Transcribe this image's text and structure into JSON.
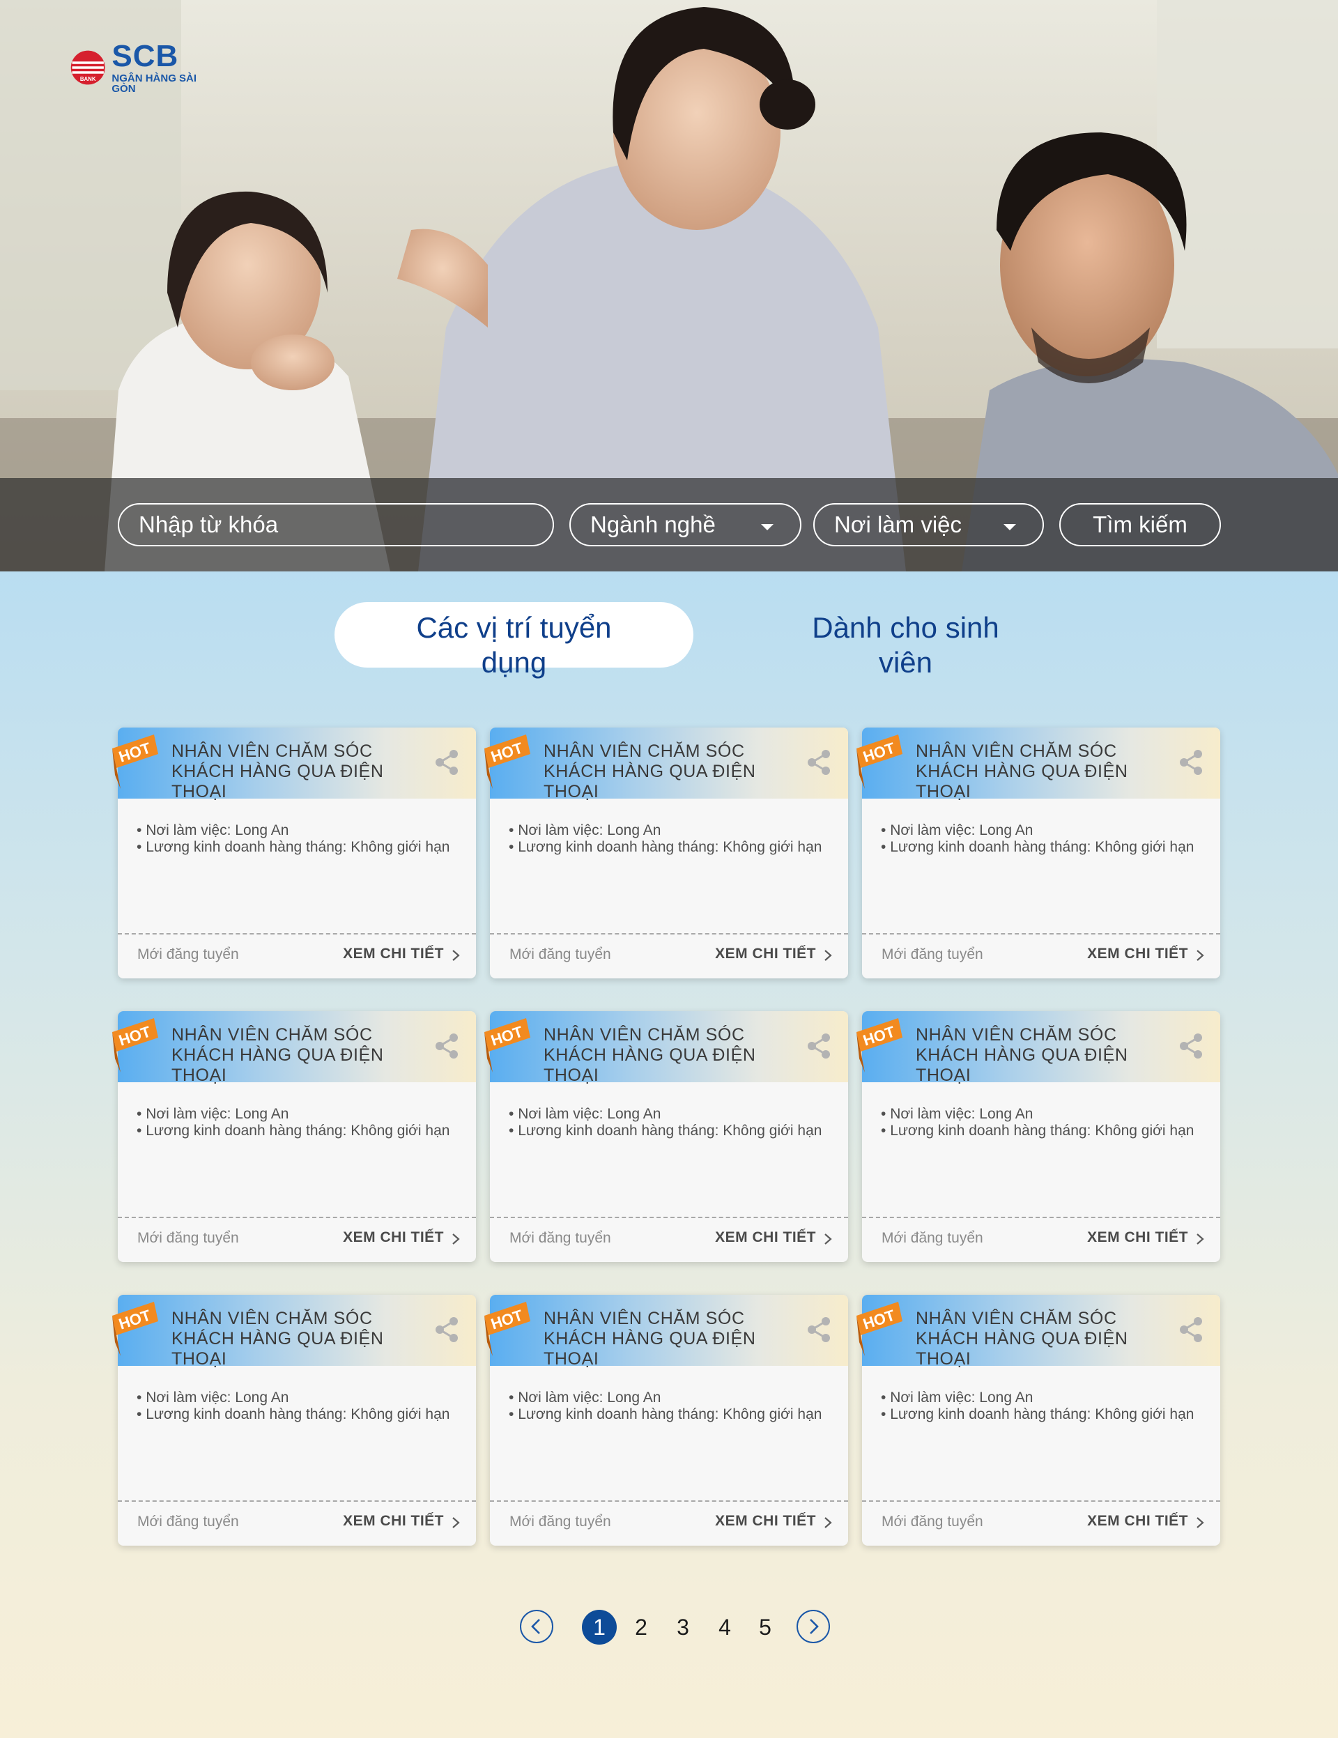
{
  "brand": {
    "name": "SCB",
    "subtitle": "NGÂN HÀNG SÀI GÒN",
    "mark_text": "BANK",
    "colors": {
      "primary": "#1a57a8",
      "accent": "#d6202e",
      "hot": "#f28a1f"
    }
  },
  "search": {
    "keyword_placeholder": "Nhập từ khóa",
    "industry_placeholder": "Ngành nghề",
    "location_placeholder": "Nơi làm việc",
    "submit_label": "Tìm kiếm"
  },
  "tabs": [
    {
      "label": "Các vị trí tuyển dụng",
      "active": true
    },
    {
      "label": "Dành cho sinh viên",
      "active": false
    }
  ],
  "jobs": [
    {
      "badge": "HOT",
      "title": "NHÂN VIÊN CHĂM SÓC KHÁCH HÀNG QUA ĐIỆN THOẠI",
      "location": "Nơi làm việc: Long An",
      "salary": "Lương kinh doanh hàng tháng: Không giới hạn",
      "status": "Mới đăng tuyển",
      "cta": "XEM CHI TIẾT"
    },
    {
      "badge": "HOT",
      "title": "NHÂN VIÊN CHĂM SÓC KHÁCH HÀNG QUA ĐIỆN THOẠI",
      "location": "Nơi làm việc: Long An",
      "salary": "Lương kinh doanh hàng tháng: Không giới hạn",
      "status": "Mới đăng tuyển",
      "cta": "XEM CHI TIẾT"
    },
    {
      "badge": "HOT",
      "title": "NHÂN VIÊN CHĂM SÓC KHÁCH HÀNG QUA ĐIỆN THOẠI",
      "location": "Nơi làm việc: Long An",
      "salary": "Lương kinh doanh hàng tháng: Không giới hạn",
      "status": "Mới đăng tuyển",
      "cta": "XEM CHI TIẾT"
    },
    {
      "badge": "HOT",
      "title": "NHÂN VIÊN CHĂM SÓC KHÁCH HÀNG QUA ĐIỆN THOẠI",
      "location": "Nơi làm việc: Long An",
      "salary": "Lương kinh doanh hàng tháng: Không giới hạn",
      "status": "Mới đăng tuyển",
      "cta": "XEM CHI TIẾT"
    },
    {
      "badge": "HOT",
      "title": "NHÂN VIÊN CHĂM SÓC KHÁCH HÀNG QUA ĐIỆN THOẠI",
      "location": "Nơi làm việc: Long An",
      "salary": "Lương kinh doanh hàng tháng: Không giới hạn",
      "status": "Mới đăng tuyển",
      "cta": "XEM CHI TIẾT"
    },
    {
      "badge": "HOT",
      "title": "NHÂN VIÊN CHĂM SÓC KHÁCH HÀNG QUA ĐIỆN THOẠI",
      "location": "Nơi làm việc: Long An",
      "salary": "Lương kinh doanh hàng tháng: Không giới hạn",
      "status": "Mới đăng tuyển",
      "cta": "XEM CHI TIẾT"
    },
    {
      "badge": "HOT",
      "title": "NHÂN VIÊN CHĂM SÓC KHÁCH HÀNG QUA ĐIỆN THOẠI",
      "location": "Nơi làm việc: Long An",
      "salary": "Lương kinh doanh hàng tháng: Không giới hạn",
      "status": "Mới đăng tuyển",
      "cta": "XEM CHI TIẾT"
    },
    {
      "badge": "HOT",
      "title": "NHÂN VIÊN CHĂM SÓC KHÁCH HÀNG QUA ĐIỆN THOẠI",
      "location": "Nơi làm việc: Long An",
      "salary": "Lương kinh doanh hàng tháng: Không giới hạn",
      "status": "Mới đăng tuyển",
      "cta": "XEM CHI TIẾT"
    },
    {
      "badge": "HOT",
      "title": "NHÂN VIÊN CHĂM SÓC KHÁCH HÀNG QUA ĐIỆN THOẠI",
      "location": "Nơi làm việc: Long An",
      "salary": "Lương kinh doanh hàng tháng: Không giới hạn",
      "status": "Mới đăng tuyển",
      "cta": "XEM CHI TIẾT"
    }
  ],
  "pagination": {
    "pages": [
      "1",
      "2",
      "3",
      "4",
      "5"
    ],
    "current": "1",
    "prev_icon": "chevron-left-icon",
    "next_icon": "chevron-right-icon"
  }
}
